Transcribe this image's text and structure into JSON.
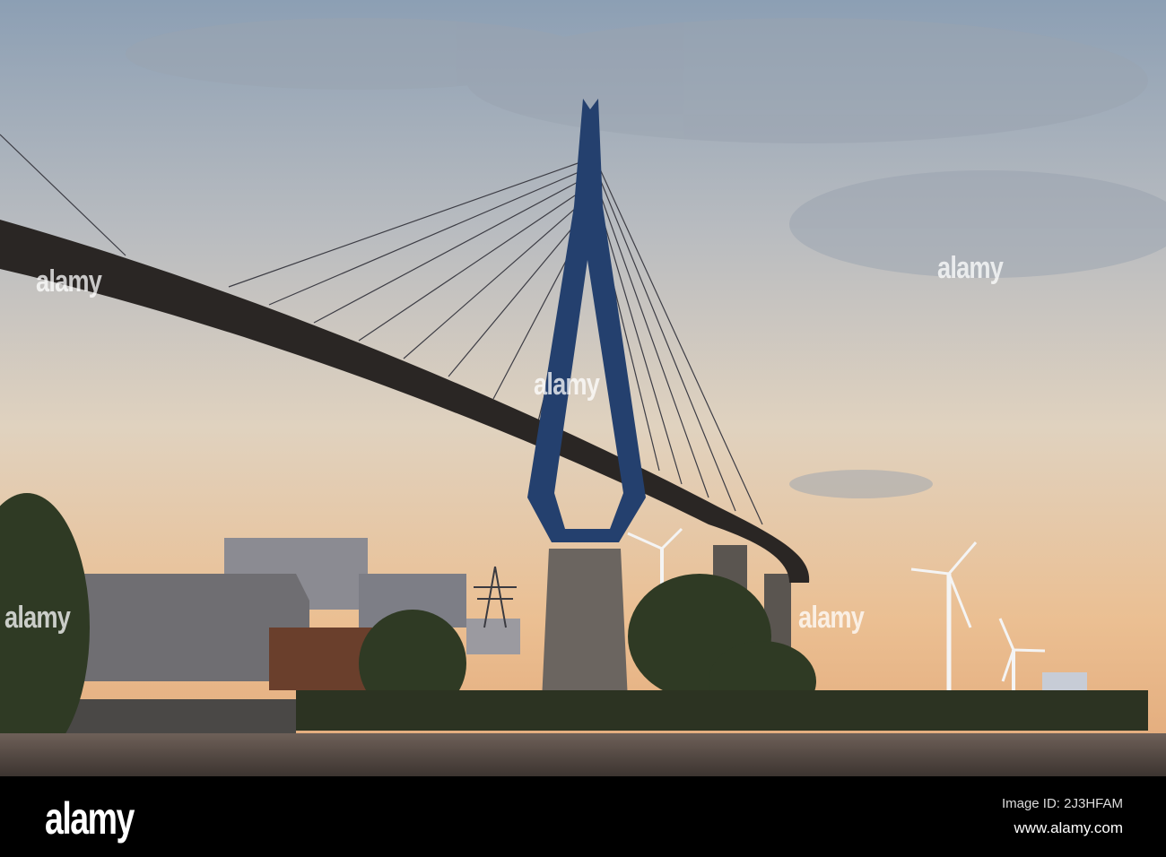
{
  "watermark": {
    "text": "alamy"
  },
  "footer": {
    "logo": "alamy",
    "image_id": "Image ID: 2J3HFAM",
    "website": "www.alamy.com"
  },
  "colors": {
    "sky_top": "#8c9fb4",
    "sky_mid": "#d9cfc0",
    "sky_horizon": "#eab889",
    "pylon": "#24406e",
    "water": "#5b5048"
  }
}
